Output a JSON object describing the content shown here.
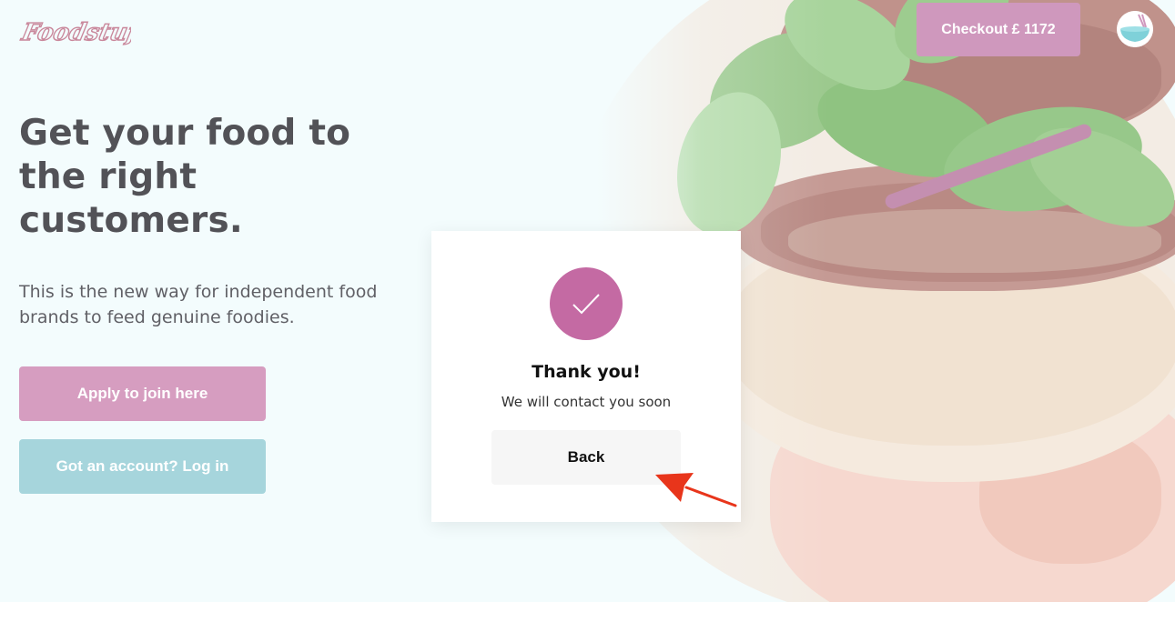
{
  "brand": {
    "logo_text": "Foodstuff",
    "logo_color": "#d69dc0"
  },
  "header": {
    "checkout_label": "Checkout £ 1172"
  },
  "hero": {
    "headline_lines": [
      "Get your food to",
      "the right",
      "customers."
    ],
    "subtext_lines": [
      "This is the new way for independent food",
      "brands to feed genuine foodies."
    ]
  },
  "actions": {
    "apply_label": "Apply to join here",
    "login_label": "Got an account? Log in"
  },
  "modal": {
    "title": "Thank you!",
    "message": "We will contact you soon",
    "back_label": "Back"
  },
  "icons": {
    "check": "check-icon",
    "avatar": "bowl-icon",
    "pointer": "arrow-icon"
  },
  "colors": {
    "accent_pink": "#d69dc0",
    "accent_teal": "#a6d5dc",
    "check_circle": "#c46aa3",
    "annotation_arrow": "#e8351b",
    "background": "#f3fcfd"
  }
}
